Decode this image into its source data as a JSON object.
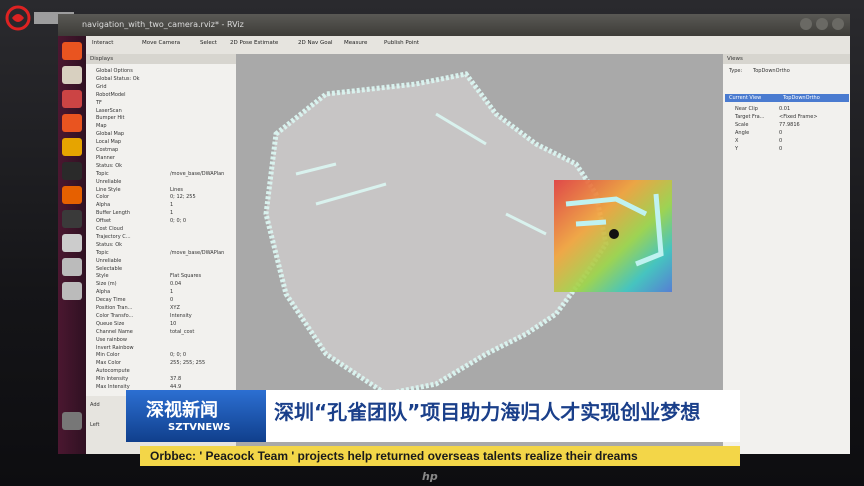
{
  "window": {
    "title": "navigation_with_two_camera.rviz* - RViz"
  },
  "toolbar": {
    "interact": "Interact",
    "move_camera": "Move Camera",
    "select": "Select",
    "pose_estimate": "2D Pose Estimate",
    "nav_goal": "2D Nav Goal",
    "measure": "Measure",
    "publish_point": "Publish Point"
  },
  "displays": {
    "title": "Displays",
    "rows": [
      {
        "label": "Global Options"
      },
      {
        "label": "Global Status: Ok"
      },
      {
        "label": "Grid"
      },
      {
        "label": "RobotModel"
      },
      {
        "label": "TF"
      },
      {
        "label": "LaserScan"
      },
      {
        "label": "Bumper Hit"
      },
      {
        "label": "Map"
      },
      {
        "label": "Global Map"
      },
      {
        "label": "Local Map"
      },
      {
        "label": "Costmap"
      },
      {
        "label": "Planner"
      },
      {
        "label": "Status: Ok"
      },
      {
        "label": "Topic",
        "value": "/move_base/DWAPlan"
      },
      {
        "label": "Unreliable"
      },
      {
        "label": "Line Style",
        "value": "Lines"
      },
      {
        "label": "Color",
        "value": "0; 12; 255"
      },
      {
        "label": "Alpha",
        "value": "1"
      },
      {
        "label": "Buffer Length",
        "value": "1"
      },
      {
        "label": "Offset",
        "value": "0; 0; 0"
      },
      {
        "label": "Cost Cloud"
      },
      {
        "label": "Trajectory C..."
      },
      {
        "label": "Status: Ok"
      },
      {
        "label": "Topic",
        "value": "/move_base/DWAPlan"
      },
      {
        "label": "Unreliable"
      },
      {
        "label": "Selectable"
      },
      {
        "label": "Style",
        "value": "Flat Squares"
      },
      {
        "label": "Size (m)",
        "value": "0.04"
      },
      {
        "label": "Alpha",
        "value": "1"
      },
      {
        "label": "Decay Time",
        "value": "0"
      },
      {
        "label": "Position Tran...",
        "value": "XYZ"
      },
      {
        "label": "Color Transfo...",
        "value": "Intensity"
      },
      {
        "label": "Queue Size",
        "value": "10"
      },
      {
        "label": "Channel Name",
        "value": "total_cost"
      },
      {
        "label": "Use rainbow"
      },
      {
        "label": "Invert Rainbow"
      },
      {
        "label": "Min Color",
        "value": "0; 0; 0"
      },
      {
        "label": "Max Color",
        "value": "255; 255; 255"
      },
      {
        "label": "Autocompute"
      },
      {
        "label": "Min Intensity",
        "value": "37.8"
      },
      {
        "label": "Max Intensity",
        "value": "44.9"
      }
    ],
    "add": "Add",
    "left": "Left"
  },
  "views": {
    "title": "Views",
    "type_label": "Type:",
    "type_value": "TopDownOrtho",
    "current_view": "Current View",
    "current_view_type": "TopDownOrtho",
    "rows": [
      {
        "label": "Near Clip",
        "value": "0.01"
      },
      {
        "label": "Target Fra...",
        "value": "<Fixed Frame>"
      },
      {
        "label": "Scale",
        "value": "77.9816"
      },
      {
        "label": "Angle",
        "value": "0"
      },
      {
        "label": "X",
        "value": "0"
      },
      {
        "label": "Y",
        "value": "0"
      }
    ]
  },
  "banner": {
    "channel_cn": "深视新闻",
    "channel_en": "SZTVNEWS",
    "headline": "深圳“孔雀团队”项目助力海归人才实现创业梦想",
    "subtitle": "Orbbec: ' Peacock Team ' projects help returned overseas talents realize their dreams"
  },
  "colors": {
    "accent": "#1a3f8a",
    "banner_blue": "#2c6fd2",
    "subtitle_bg": "#f3d648"
  },
  "laptop_brand": "hp"
}
